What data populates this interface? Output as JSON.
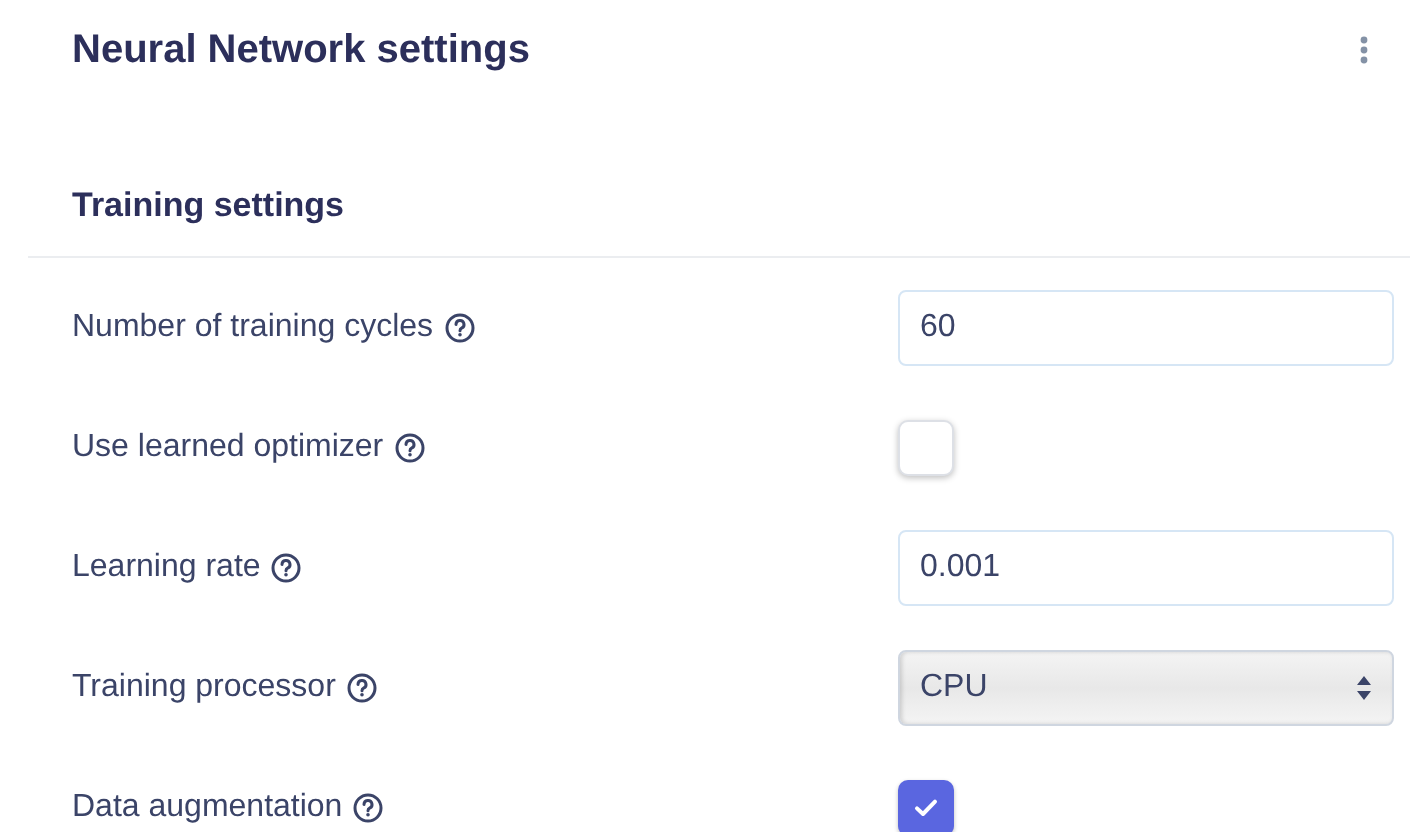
{
  "title": "Neural Network settings",
  "section": {
    "title": "Training settings"
  },
  "fields": [
    {
      "label": "Number of training cycles",
      "kind": "text",
      "value": "60"
    },
    {
      "label": "Use learned optimizer",
      "kind": "checkbox",
      "checked": false
    },
    {
      "label": "Learning rate",
      "kind": "text",
      "value": "0.001"
    },
    {
      "label": "Training processor",
      "kind": "select",
      "value": "CPU"
    },
    {
      "label": "Data augmentation",
      "kind": "checkbox",
      "checked": true
    }
  ]
}
